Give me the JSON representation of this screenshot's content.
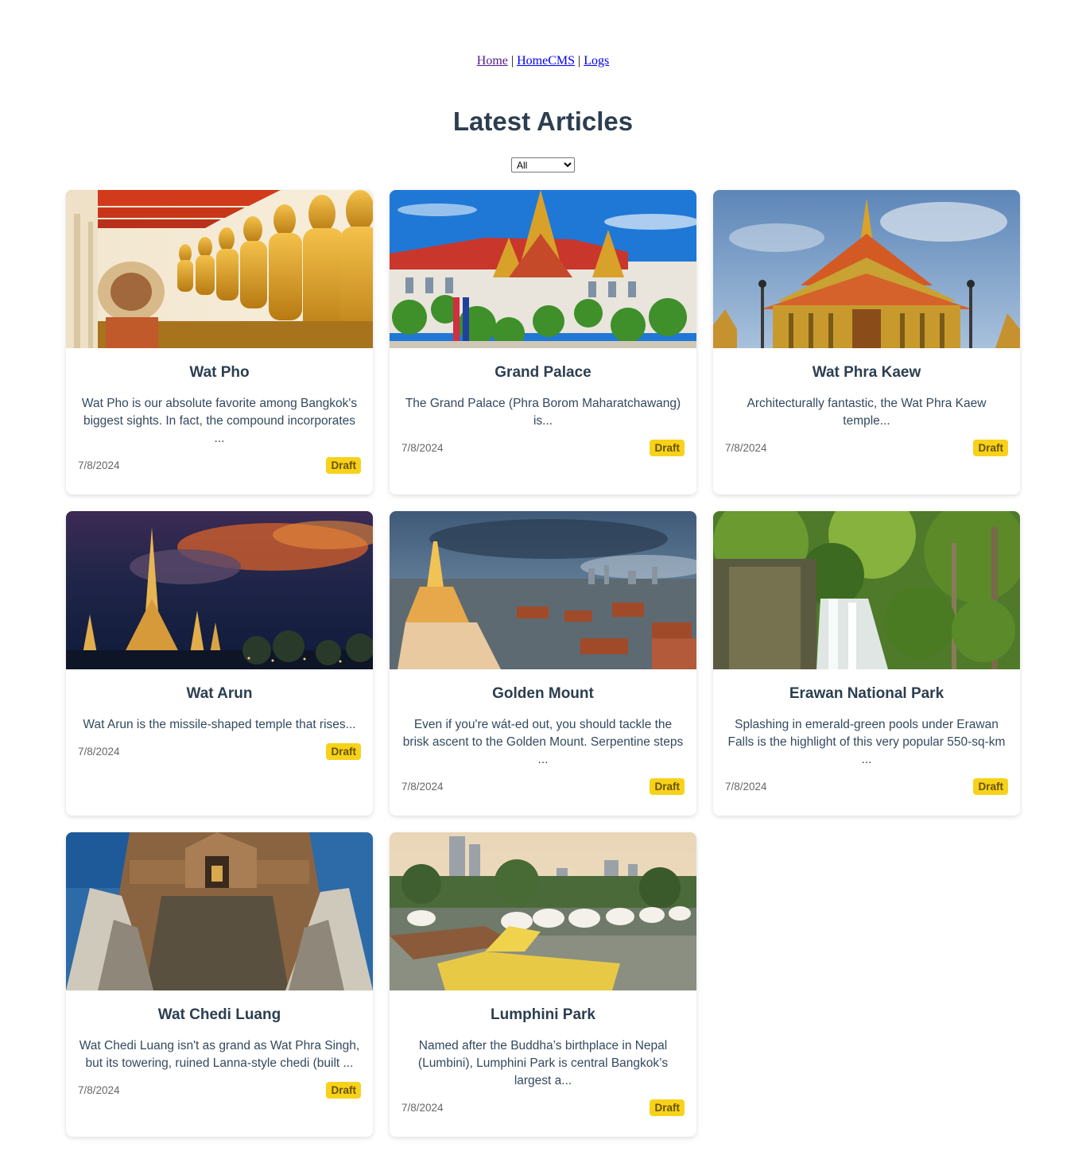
{
  "nav": {
    "links": [
      {
        "label": "Home"
      },
      {
        "label": "HomeCMS"
      },
      {
        "label": "Logs"
      }
    ],
    "separator": "|"
  },
  "page": {
    "title": "Latest Articles"
  },
  "filter": {
    "selected": "All"
  },
  "articles": [
    {
      "title": "Wat Pho",
      "excerpt": "Wat Pho is our absolute favorite among Bangkok's biggest sights. In fact, the compound incorporates ...",
      "date": "7/8/2024",
      "status": "Draft",
      "image": "golden-buddha-statues-photo"
    },
    {
      "title": "Grand Palace",
      "excerpt": "The Grand Palace (Phra Borom Maharatchawang) is...",
      "date": "7/8/2024",
      "status": "Draft",
      "image": "grand-palace-photo"
    },
    {
      "title": "Wat Phra Kaew",
      "excerpt": "Architecturally fantastic, the Wat Phra Kaew temple...",
      "date": "7/8/2024",
      "status": "Draft",
      "image": "wat-phra-kaew-photo"
    },
    {
      "title": "Wat Arun",
      "excerpt": "Wat Arun is the missile-shaped temple that rises...",
      "date": "7/8/2024",
      "status": "Draft",
      "image": "wat-arun-sunset-photo"
    },
    {
      "title": "Golden Mount",
      "excerpt": "Even if you're wát-ed out, you should tackle the brisk ascent to the Golden Mount. Serpentine steps ...",
      "date": "7/8/2024",
      "status": "Draft",
      "image": "golden-mount-city-photo"
    },
    {
      "title": "Erawan National Park",
      "excerpt": "Splashing in emerald-green pools under Erawan Falls is the highlight of this very popular 550-sq-km ...",
      "date": "7/8/2024",
      "status": "Draft",
      "image": "waterfall-forest-photo"
    },
    {
      "title": "Wat Chedi Luang",
      "excerpt": "Wat Chedi Luang isn't as grand as Wat Phra Singh, but its towering, ruined Lanna-style chedi (built ...",
      "date": "7/8/2024",
      "status": "Draft",
      "image": "ruined-chedi-photo"
    },
    {
      "title": "Lumphini Park",
      "excerpt": "Named after the Buddha’s birthplace in Nepal (Lumbini), Lumphini Park is central Bangkok’s largest a...",
      "date": "7/8/2024",
      "status": "Draft",
      "image": "park-lake-swan-boats-photo"
    }
  ]
}
